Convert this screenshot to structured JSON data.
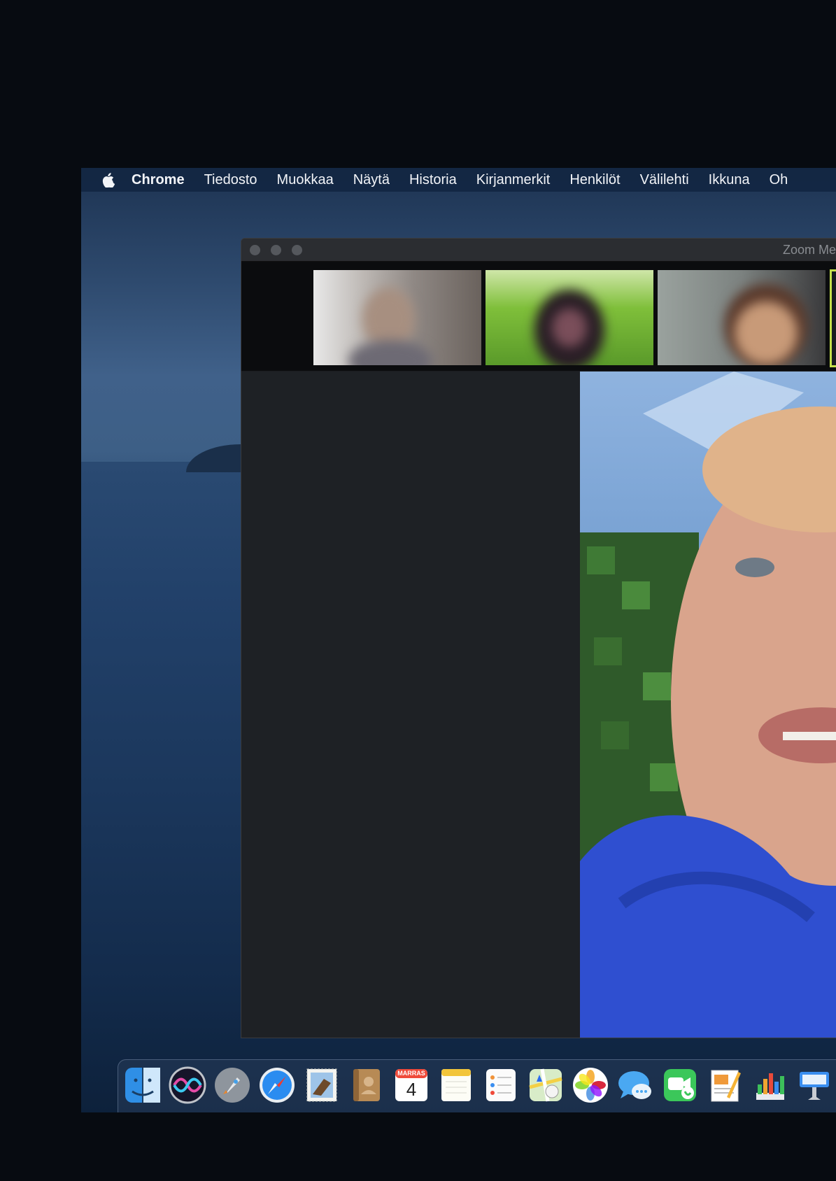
{
  "menubar": {
    "apple_icon": "apple-logo-icon",
    "app_name": "Chrome",
    "items": [
      "Tiedosto",
      "Muokkaa",
      "Näytä",
      "Historia",
      "Kirjanmerkit",
      "Henkilöt",
      "Välilehti",
      "Ikkuna",
      "Oh"
    ]
  },
  "zoom_window": {
    "title": "Zoom Me",
    "participants": [
      "participant-1",
      "participant-2",
      "participant-3"
    ],
    "active_speaker": "speaker-video"
  },
  "dock": {
    "apps": [
      {
        "name": "finder",
        "icon": "finder-icon"
      },
      {
        "name": "siri",
        "icon": "siri-icon"
      },
      {
        "name": "launchpad",
        "icon": "rocket-icon"
      },
      {
        "name": "safari",
        "icon": "compass-icon"
      },
      {
        "name": "mail",
        "icon": "stamp-icon"
      },
      {
        "name": "contacts",
        "icon": "contacts-book-icon"
      },
      {
        "name": "calendar",
        "icon": "calendar-icon",
        "month": "MARRAS",
        "day": "4"
      },
      {
        "name": "notes",
        "icon": "notes-icon"
      },
      {
        "name": "reminders",
        "icon": "reminders-icon"
      },
      {
        "name": "maps",
        "icon": "maps-icon"
      },
      {
        "name": "photos",
        "icon": "photos-icon"
      },
      {
        "name": "messages",
        "icon": "messages-icon"
      },
      {
        "name": "facetime",
        "icon": "facetime-icon"
      },
      {
        "name": "pages",
        "icon": "pages-icon"
      },
      {
        "name": "numbers",
        "icon": "numbers-icon"
      },
      {
        "name": "keynote",
        "icon": "keynote-icon"
      }
    ]
  },
  "colors": {
    "background": "#070b11",
    "menubar": "#122642",
    "zoom_panel": "#1e2125",
    "active_border": "#c6e04a",
    "hoodie": "#2f4fd0"
  }
}
